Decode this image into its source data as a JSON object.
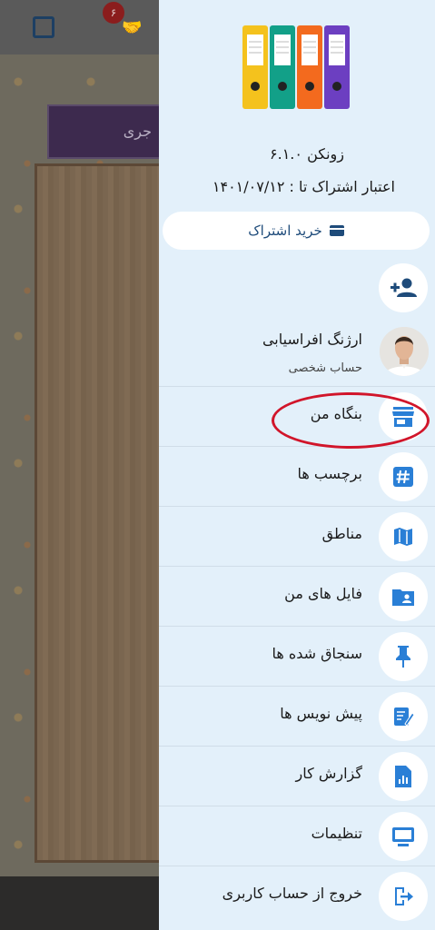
{
  "background": {
    "badge": "۶",
    "banner_text": "جری"
  },
  "drawer": {
    "app_version": "زونکن ۶.۱.۰",
    "subscription_validity": "اعتبار اشتراک تا : ۱۴۰۱/۰۷/۱۲",
    "buy_button_label": "خرید اشتراک",
    "profile": {
      "name": "ارژنگ افراسیابی",
      "account_type": "حساب شخصی"
    },
    "menu": [
      {
        "label": "بنگاه من",
        "icon": "store-icon"
      },
      {
        "label": "برچسب ها",
        "icon": "hashtag-icon"
      },
      {
        "label": "مناطق",
        "icon": "map-icon"
      },
      {
        "label": "فایل های من",
        "icon": "folder-user-icon"
      },
      {
        "label": "سنجاق شده ها",
        "icon": "pin-icon"
      },
      {
        "label": "پیش نویس ها",
        "icon": "draft-icon"
      },
      {
        "label": "گزارش کار",
        "icon": "report-icon"
      },
      {
        "label": "تنظیمات",
        "icon": "monitor-icon"
      },
      {
        "label": "خروج از حساب کاربری",
        "icon": "logout-icon"
      }
    ]
  },
  "colors": {
    "drawer_bg": "#e3f0fa",
    "icon_blue": "#2a7fd6",
    "highlight_red": "#d1152a"
  }
}
